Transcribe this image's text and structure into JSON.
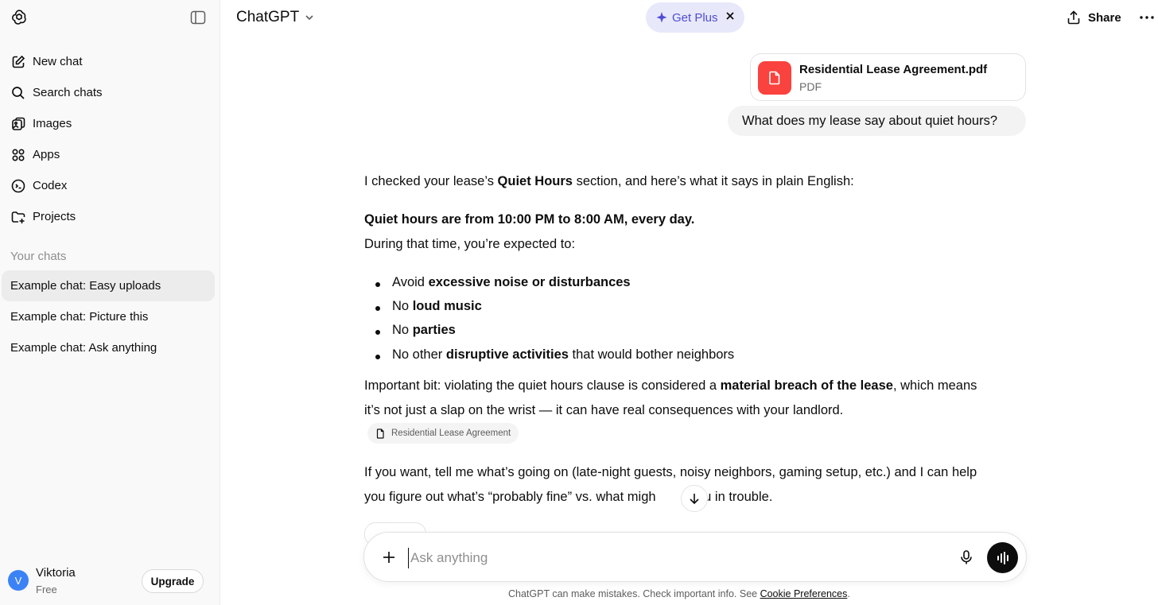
{
  "sidebar": {
    "items": [
      {
        "label": "New chat",
        "icon": "new-chat-icon"
      },
      {
        "label": "Search chats",
        "icon": "search-icon"
      },
      {
        "label": "Images",
        "icon": "images-icon"
      },
      {
        "label": "Apps",
        "icon": "apps-icon"
      },
      {
        "label": "Codex",
        "icon": "codex-icon"
      },
      {
        "label": "Projects",
        "icon": "projects-icon"
      }
    ],
    "section_title": "Your chats",
    "chats": [
      "Example chat: Easy uploads",
      "Example chat: Picture this",
      "Example chat: Ask anything"
    ],
    "user": {
      "initial": "V",
      "name": "Viktoria",
      "plan": "Free",
      "upgrade_label": "Upgrade"
    }
  },
  "header": {
    "model": "ChatGPT",
    "get_plus": "Get Plus",
    "share": "Share"
  },
  "conversation": {
    "file": {
      "name": "Residential Lease Agreement.pdf",
      "type": "PDF"
    },
    "user_message": "What does my lease say about quiet hours?",
    "answer": {
      "intro_pre": "I checked your lease’s ",
      "intro_bold": "Quiet Hours",
      "intro_post": " section, and here’s what it says in plain English:",
      "headline": "Quiet hours are from 10:00 PM to 8:00 AM, every day.",
      "during": "During that time, you’re expected to:",
      "bullets": [
        {
          "pre": "Avoid ",
          "bold": "excessive noise or disturbances",
          "post": ""
        },
        {
          "pre": "No ",
          "bold": "loud music",
          "post": ""
        },
        {
          "pre": "No ",
          "bold": "parties",
          "post": ""
        },
        {
          "pre": "No other ",
          "bold": "disruptive activities",
          "post": " that would bother neighbors"
        }
      ],
      "important_pre": "Important bit: violating the quiet hours clause is considered a ",
      "important_bold": "material breach of the lease",
      "important_post": ", which means",
      "important_line2": "it’s not just a slap on the wrist — it can have real consequences with your landlord.",
      "citation": "Residential Lease Agreement",
      "closing_line1": "If you want, tell me what’s going on (late-night guests, noisy neighbors, gaming setup, etc.) and I can help",
      "closing_line2_pre": "you figure out what’s “probably fine” vs. what migh",
      "closing_line2_post": "t you in trouble."
    }
  },
  "composer": {
    "placeholder": "Ask anything"
  },
  "footer": {
    "disclaimer": "ChatGPT can make mistakes. Check important info. See ",
    "link": "Cookie Preferences",
    "end": "."
  },
  "colors": {
    "accent_plus": "#4d4dd3",
    "plus_bg": "#e8e8fb",
    "pdf_red": "#fa423e",
    "avatar_blue": "#3b82f6"
  }
}
